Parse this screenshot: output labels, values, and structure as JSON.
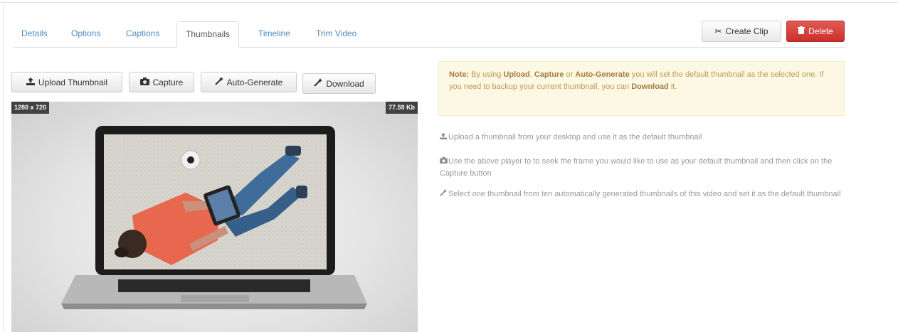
{
  "tabs": [
    {
      "label": "Details"
    },
    {
      "label": "Options"
    },
    {
      "label": "Captions"
    },
    {
      "label": "Thumbnails"
    },
    {
      "label": "Timeline"
    },
    {
      "label": "Trim Video"
    }
  ],
  "actions": {
    "create_clip": "Create Clip",
    "delete": "Delete"
  },
  "toolbar": {
    "upload": "Upload Thumbnail",
    "capture": "Capture",
    "auto_generate": "Auto-Generate",
    "download": "Download"
  },
  "thumbnail": {
    "resolution": "1280 x 720",
    "size": "77.59 Kb"
  },
  "note": {
    "prefix": "Note:",
    "t1": " By using ",
    "k1": "Upload",
    "t2": ", ",
    "k2": "Capture",
    "t3": " or ",
    "k3": "Auto-Generate",
    "t4": " you will set the default thumbnail as the selected one. If you need to backup your current thumbnail, you can ",
    "k4": "Download",
    "t5": " it."
  },
  "help": {
    "upload": "Upload a thumbnail from your desktop and use it as the default thumbnail",
    "capture": "Use the above player to to seek the frame you would like to use as your default thumbnail and then click on the Capture button",
    "auto": "Select one thumbnail from ten automatically generated thumbnails of this video and set it as the default thumbnail"
  },
  "colors": {
    "link": "#4a8cc7",
    "danger": "#d9534f",
    "note_bg": "#fcf8e3",
    "note_text": "#c09853"
  }
}
